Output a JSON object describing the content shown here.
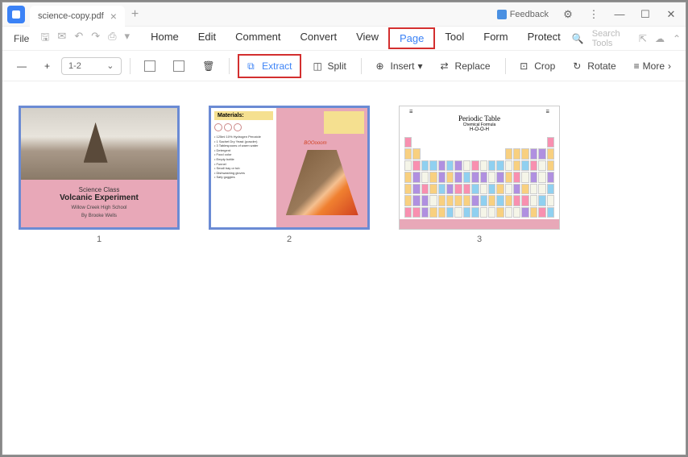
{
  "titlebar": {
    "filename": "science-copy.pdf",
    "feedback": "Feedback"
  },
  "menubar": {
    "file": "File",
    "items": [
      "Home",
      "Edit",
      "Comment",
      "Convert",
      "View",
      "Page",
      "Tool",
      "Form",
      "Protect"
    ],
    "search_placeholder": "Search Tools"
  },
  "toolbar": {
    "page_range": "1-2",
    "extract": "Extract",
    "split": "Split",
    "insert": "Insert",
    "replace": "Replace",
    "crop": "Crop",
    "rotate": "Rotate",
    "more": "More"
  },
  "thumbnails": [
    {
      "num": "1",
      "selected": true,
      "slide1": {
        "title1": "Science Class",
        "title2": "Volcanic Experiment",
        "sub1": "Willow Creek High School",
        "sub2": "By Brooke Wells"
      }
    },
    {
      "num": "2",
      "selected": true,
      "slide2": {
        "materials_label": "Materials:",
        "boom": "BOOooom",
        "list": "• 125ml 10% Hydrogen Peroxide\n• 1 Sachet Dry Yeast (powder)\n• 3 Tablespoons of warm water\n• Detergent\n• Food color\n• Empty bottle\n• Funnel\n• Small tray or tub\n• Dishwashing gloves\n• Safy goggles"
      }
    },
    {
      "num": "3",
      "selected": false,
      "slide3": {
        "title": "Periodic Table",
        "sub": "Chemical Formula",
        "formula": "H-O-O-H"
      }
    }
  ]
}
